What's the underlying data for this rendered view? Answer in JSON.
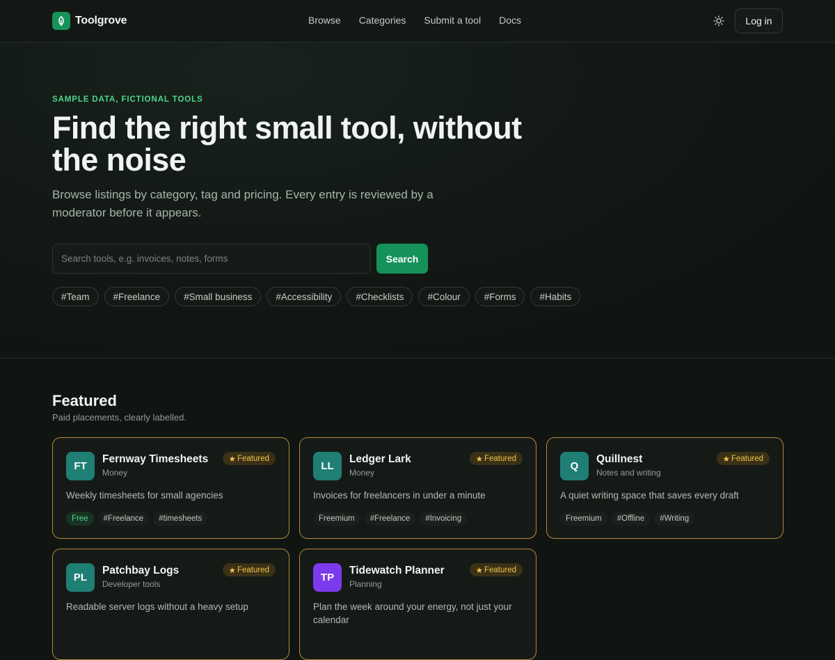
{
  "header": {
    "brand": "Toolgrove",
    "nav": [
      "Browse",
      "Categories",
      "Submit a tool",
      "Docs"
    ],
    "login_label": "Log in",
    "theme_icon": "sun-icon"
  },
  "hero": {
    "eyebrow": "SAMPLE DATA, FICTIONAL TOOLS",
    "title": "Find the right small tool, without the noise",
    "subtitle": "Browse listings by category, tag and pricing. Every entry is reviewed by a moderator before it appears.",
    "search_placeholder": "Search tools, e.g. invoices, notes, forms",
    "search_value": "",
    "search_button": "Search",
    "tags": [
      "#Team",
      "#Freelance",
      "#Small business",
      "#Accessibility",
      "#Checklists",
      "#Colour",
      "#Forms",
      "#Habits"
    ]
  },
  "featured": {
    "title": "Featured",
    "subtitle": "Paid placements, clearly labelled.",
    "badge_label": "Featured",
    "cards": [
      {
        "initials": "FT",
        "name": "Fernway Timesheets",
        "category": "Money",
        "description": "Weekly timesheets for small agencies",
        "tags": [
          "Free",
          "#Freelance",
          "#timesheets"
        ],
        "avatar_color": "#1f7f75"
      },
      {
        "initials": "LL",
        "name": "Ledger Lark",
        "category": "Money",
        "description": "Invoices for freelancers in under a minute",
        "tags": [
          "Freemium",
          "#Freelance",
          "#Invoicing"
        ],
        "avatar_color": "#1f7f75"
      },
      {
        "initials": "Q",
        "name": "Quillnest",
        "category": "Notes and writing",
        "description": "A quiet writing space that saves every draft",
        "tags": [
          "Freemium",
          "#Offline",
          "#Writing"
        ],
        "avatar_color": "#1f7f75"
      },
      {
        "initials": "PL",
        "name": "Patchbay Logs",
        "category": "Developer tools",
        "description": "Readable server logs without a heavy setup",
        "tags": [],
        "avatar_color": "#1f7f75"
      },
      {
        "initials": "TP",
        "name": "Tidewatch Planner",
        "category": "Planning",
        "description": "Plan the week around your energy, not just your calendar",
        "tags": [],
        "avatar_color": "#7c3aed"
      }
    ]
  },
  "colors": {
    "accent": "#15915a",
    "accent_text": "#4fd58c",
    "featured_border": "#b58a37",
    "badge_text": "#f0c34a"
  }
}
